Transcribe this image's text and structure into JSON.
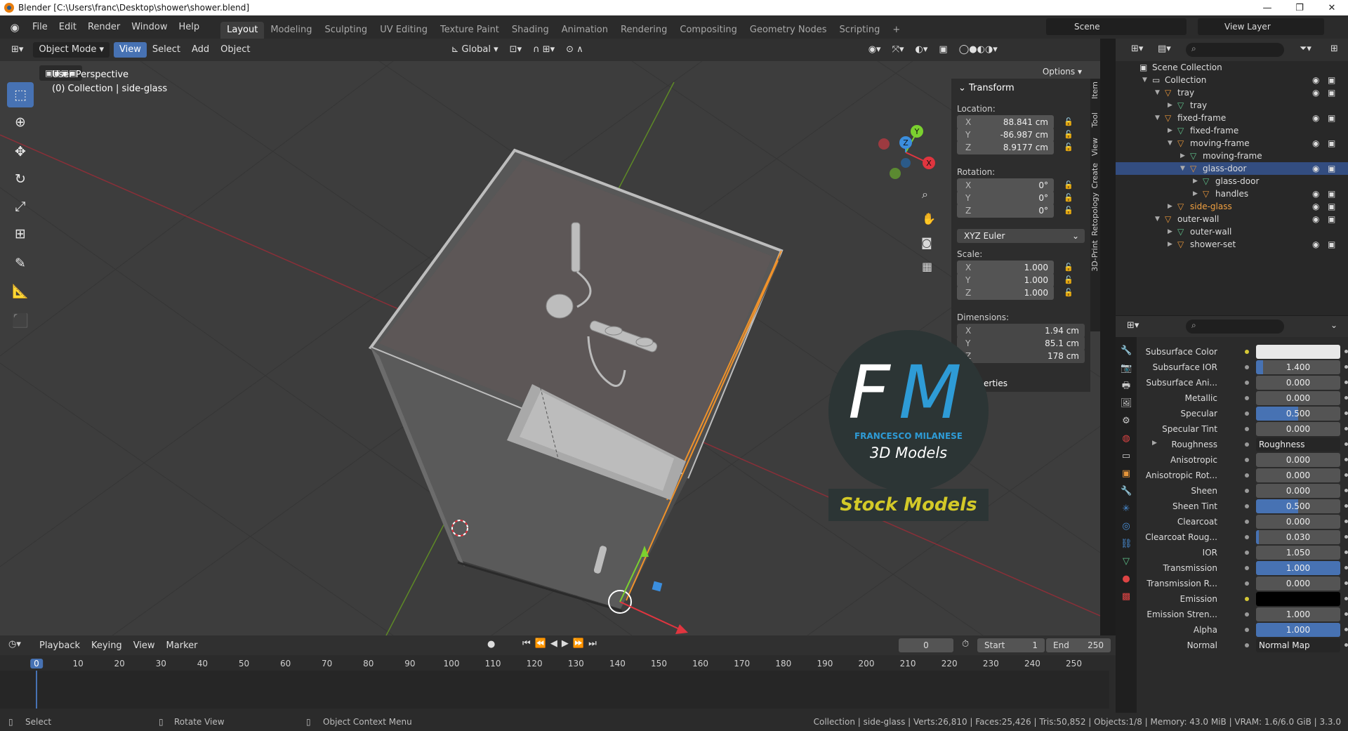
{
  "window": {
    "title": "Blender [C:\\Users\\franc\\Desktop\\shower\\shower.blend]",
    "minimize": "—",
    "maximize": "❐",
    "close": "✕"
  },
  "menu": [
    "File",
    "Edit",
    "Render",
    "Window",
    "Help"
  ],
  "workspaces": [
    "Layout",
    "Modeling",
    "Sculpting",
    "UV Editing",
    "Texture Paint",
    "Shading",
    "Animation",
    "Rendering",
    "Compositing",
    "Geometry Nodes",
    "Scripting",
    "+"
  ],
  "active_workspace": "Layout",
  "scene": "Scene",
  "view_layer": "View Layer",
  "viewport": {
    "mode": "Object Mode",
    "menus": [
      "View",
      "Select",
      "Add",
      "Object"
    ],
    "orientation": "Global",
    "options": "Options",
    "perspective_label": "User Perspective",
    "collection_label": "(0) Collection | side-glass"
  },
  "tools": [
    "select-box-icon",
    "cursor-icon",
    "move-icon",
    "rotate-icon",
    "scale-icon",
    "transform-icon",
    "annotate-icon",
    "measure-icon",
    "add-cube-icon"
  ],
  "gizmo": {
    "x": "X",
    "y": "Y",
    "z": "Z"
  },
  "transform_panel": {
    "title": "Transform",
    "location_label": "Location:",
    "location": [
      {
        "axis": "X",
        "value": "88.841 cm"
      },
      {
        "axis": "Y",
        "value": "-86.987 cm"
      },
      {
        "axis": "Z",
        "value": "8.9177 cm"
      }
    ],
    "rotation_label": "Rotation:",
    "rotation": [
      {
        "axis": "X",
        "value": "0°"
      },
      {
        "axis": "Y",
        "value": "0°"
      },
      {
        "axis": "Z",
        "value": "0°"
      }
    ],
    "rotation_mode": "XYZ Euler",
    "scale_label": "Scale:",
    "scale": [
      {
        "axis": "X",
        "value": "1.000"
      },
      {
        "axis": "Y",
        "value": "1.000"
      },
      {
        "axis": "Z",
        "value": "1.000"
      }
    ],
    "dimensions_label": "Dimensions:",
    "dimensions": [
      {
        "axis": "X",
        "value": "1.94 cm"
      },
      {
        "axis": "Y",
        "value": "85.1 cm"
      },
      {
        "axis": "Z",
        "value": "178 cm"
      }
    ],
    "properties_partial": "erties"
  },
  "side_tabs": [
    "Item",
    "Tool",
    "View",
    "Create",
    "Retopology",
    "3D-Print"
  ],
  "logo": {
    "letters": "FM",
    "name": "FRANCESCO MILANESE",
    "subtitle": "3D Models",
    "banner": "Stock Models"
  },
  "outliner": {
    "rows": [
      {
        "label": "Scene Collection",
        "indent": 0,
        "type": "scene",
        "tri": ""
      },
      {
        "label": "Collection",
        "indent": 1,
        "type": "collection",
        "tri": "▼",
        "vis": true
      },
      {
        "label": "tray",
        "indent": 2,
        "type": "object",
        "tri": "▼",
        "vis": true
      },
      {
        "label": "tray",
        "indent": 3,
        "type": "mesh",
        "tri": "▶"
      },
      {
        "label": "fixed-frame",
        "indent": 2,
        "type": "object",
        "tri": "▼",
        "vis": true
      },
      {
        "label": "fixed-frame",
        "indent": 3,
        "type": "mesh",
        "tri": "▶"
      },
      {
        "label": "moving-frame",
        "indent": 3,
        "type": "object",
        "tri": "▼",
        "vis": true
      },
      {
        "label": "moving-frame",
        "indent": 4,
        "type": "mesh",
        "tri": "▶"
      },
      {
        "label": "glass-door",
        "indent": 4,
        "type": "object",
        "tri": "▼",
        "vis": true,
        "selected": true
      },
      {
        "label": "glass-door",
        "indent": 5,
        "type": "mesh",
        "tri": "▶"
      },
      {
        "label": "handles",
        "indent": 5,
        "type": "object",
        "tri": "▶",
        "vis": true
      },
      {
        "label": "side-glass",
        "indent": 3,
        "type": "object",
        "tri": "▶",
        "vis": true,
        "active": true
      },
      {
        "label": "outer-wall",
        "indent": 2,
        "type": "object",
        "tri": "▼",
        "vis": true
      },
      {
        "label": "outer-wall",
        "indent": 3,
        "type": "mesh",
        "tri": "▶"
      },
      {
        "label": "shower-set",
        "indent": 3,
        "type": "object",
        "tri": "▶",
        "vis": true
      }
    ]
  },
  "material": {
    "rows": [
      {
        "label": "Subsurface Color",
        "value": "",
        "dot": "yellow",
        "swatch": "#e8e8e8"
      },
      {
        "label": "Subsurface IOR",
        "value": "1.400",
        "fill": 0.08
      },
      {
        "label": "Subsurface Ani...",
        "value": "0.000"
      },
      {
        "label": "Metallic",
        "value": "0.000"
      },
      {
        "label": "Specular",
        "value": "0.500",
        "fill": 0.5
      },
      {
        "label": "Specular Tint",
        "value": "0.000"
      },
      {
        "label": "Roughness",
        "value": "Roughness",
        "link": true
      },
      {
        "label": "Anisotropic",
        "value": "0.000"
      },
      {
        "label": "Anisotropic Rot...",
        "value": "0.000"
      },
      {
        "label": "Sheen",
        "value": "0.000"
      },
      {
        "label": "Sheen Tint",
        "value": "0.500",
        "fill": 0.5
      },
      {
        "label": "Clearcoat",
        "value": "0.000"
      },
      {
        "label": "Clearcoat Roug...",
        "value": "0.030",
        "fill": 0.03
      },
      {
        "label": "IOR",
        "value": "1.050"
      },
      {
        "label": "Transmission",
        "value": "1.000",
        "fill": 1.0
      },
      {
        "label": "Transmission R...",
        "value": "0.000"
      },
      {
        "label": "Emission",
        "value": "",
        "dot": "yellow",
        "swatch": "#000000"
      },
      {
        "label": "Emission Stren...",
        "value": "1.000"
      },
      {
        "label": "Alpha",
        "value": "1.000",
        "fill": 1.0
      },
      {
        "label": "Normal",
        "value": "Normal Map",
        "link": true
      }
    ]
  },
  "timeline": {
    "menus": [
      "Playback",
      "Keying",
      "View",
      "Marker"
    ],
    "current_frame": "0",
    "start_label": "Start",
    "start": "1",
    "end_label": "End",
    "end": "250",
    "ticks": [
      "0",
      "10",
      "20",
      "30",
      "40",
      "50",
      "60",
      "70",
      "80",
      "90",
      "100",
      "110",
      "120",
      "130",
      "140",
      "150",
      "160",
      "170",
      "180",
      "190",
      "200",
      "210",
      "220",
      "230",
      "240",
      "250"
    ]
  },
  "statusbar": {
    "left": [
      "Select",
      "Rotate View",
      "Object Context Menu"
    ],
    "right": "Collection | side-glass | Verts:26,810 | Faces:25,426 | Tris:50,852 | Objects:1/8 | Memory: 43.0 MiB | VRAM: 1.6/6.0 GiB | 3.3.0"
  },
  "colors": {
    "accent": "#4772b3",
    "selection_orange": "#f0922a",
    "axis_x": "#e0353f",
    "axis_y": "#7bd12f",
    "axis_z": "#3b8ede"
  }
}
